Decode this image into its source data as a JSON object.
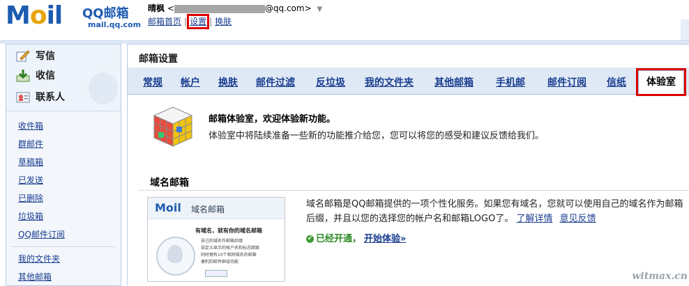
{
  "header": {
    "logo_mark": "M",
    "logo_mark_accent": "o",
    "logo_mark_tail": "il",
    "brand": "QQ邮箱",
    "brand_domain": "mail.qq.com",
    "user_name": "晴枫",
    "user_email_prefix": "<",
    "user_email_suffix": "@qq.com>",
    "links": [
      {
        "label": "邮箱首页"
      },
      {
        "label": "设置"
      },
      {
        "label": "换肤"
      }
    ]
  },
  "quick_actions": [
    {
      "label": "写信",
      "icon": "compose-icon"
    },
    {
      "label": "收信",
      "icon": "inbox-download-icon"
    },
    {
      "label": "联系人",
      "icon": "contacts-icon"
    }
  ],
  "folders": {
    "group1": [
      "收件箱",
      "群邮件",
      "草稿箱",
      "已发送",
      "已删除",
      "垃圾箱",
      "QQ邮件订阅"
    ],
    "group2": [
      "我的文件夹",
      "其他邮箱"
    ]
  },
  "main": {
    "title": "邮箱设置",
    "tabs": [
      "常规",
      "帐户",
      "换肤",
      "邮件过滤",
      "反垃圾",
      "我的文件夹",
      "其他邮箱",
      "手机邮",
      "邮件订阅",
      "信纸",
      "体验室"
    ],
    "active_tab": "体验室",
    "intro_title": "邮箱体验室，欢迎体验新功能。",
    "intro_desc": "体验室中将陆续准备一些新的功能推介给您，您可以将您的感受和建议反馈给我们。",
    "section_title": "域名邮箱",
    "preview": {
      "logo": "Moil",
      "tag": "域名邮箱",
      "headline": "有域名，就有你的域名邮箱",
      "bullets": [
        "自己的域名作邮箱后缀",
        "自定义显示的帐户名和标志图案",
        "同时拥有10个相同域名的邮箱",
        "便利的邮件群组功能"
      ],
      "button": "了解更多"
    },
    "detail_text": "域名邮箱是QQ邮箱提供的一项个性化服务。如果您有域名，您就可以使用自己的域名作为邮箱后缀，并且以您的选择您的帐户名和邮箱LOGO了。",
    "detail_links": [
      "了解详情",
      "意见反馈"
    ],
    "status_text": "已经开通，",
    "status_link": "开始体验»"
  },
  "watermark": "witmax.cn",
  "colors": {
    "brand_blue": "#1c5bb0",
    "tab_bar": "#dfe9f5",
    "highlight": "#d00000",
    "success": "#2f8a25"
  }
}
